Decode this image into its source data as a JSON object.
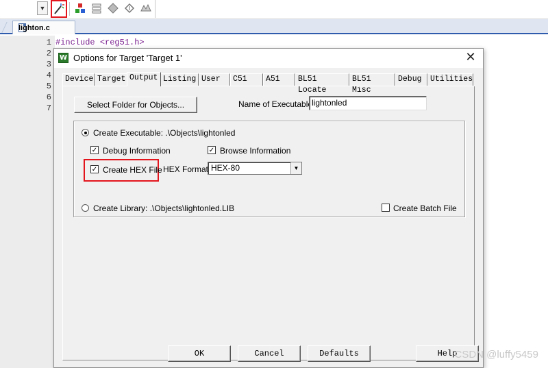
{
  "editor": {
    "file_tab": "lighton.c",
    "line_numbers": [
      "1",
      "2",
      "3",
      "4",
      "5",
      "6",
      "7"
    ],
    "code_kw": "#include",
    "code_arg": "<reg51.h>"
  },
  "dialog": {
    "title": "Options for Target 'Target 1'",
    "close": "✕",
    "tabs": [
      "Device",
      "Target",
      "Output",
      "Listing",
      "User",
      "C51",
      "A51",
      "BL51 Locate",
      "BL51 Misc",
      "Debug",
      "Utilities"
    ],
    "active_tab": "Output",
    "select_folder_button": "Select Folder for Objects...",
    "name_label": "Name of Executable:",
    "name_value": "lightonled",
    "create_executable": "Create Executable:  .\\Objects\\lightonled",
    "create_executable_checked": true,
    "debug_info": "Debug Information",
    "debug_info_checked": true,
    "browse_info": "Browse Information",
    "browse_info_checked": true,
    "create_hex": "Create HEX File",
    "create_hex_checked": true,
    "hex_format_label": "HEX Format:",
    "hex_format_value": "HEX-80",
    "create_library": "Create Library:  .\\Objects\\lightonled.LIB",
    "create_library_checked": false,
    "create_batch": "Create Batch File",
    "create_batch_checked": false,
    "ok": "OK",
    "cancel": "Cancel",
    "defaults": "Defaults",
    "help": "Help"
  },
  "watermark": "CSDN @luffy5459",
  "colors": {
    "highlight": "#e3141b",
    "tab_accent": "#2f5cac"
  }
}
